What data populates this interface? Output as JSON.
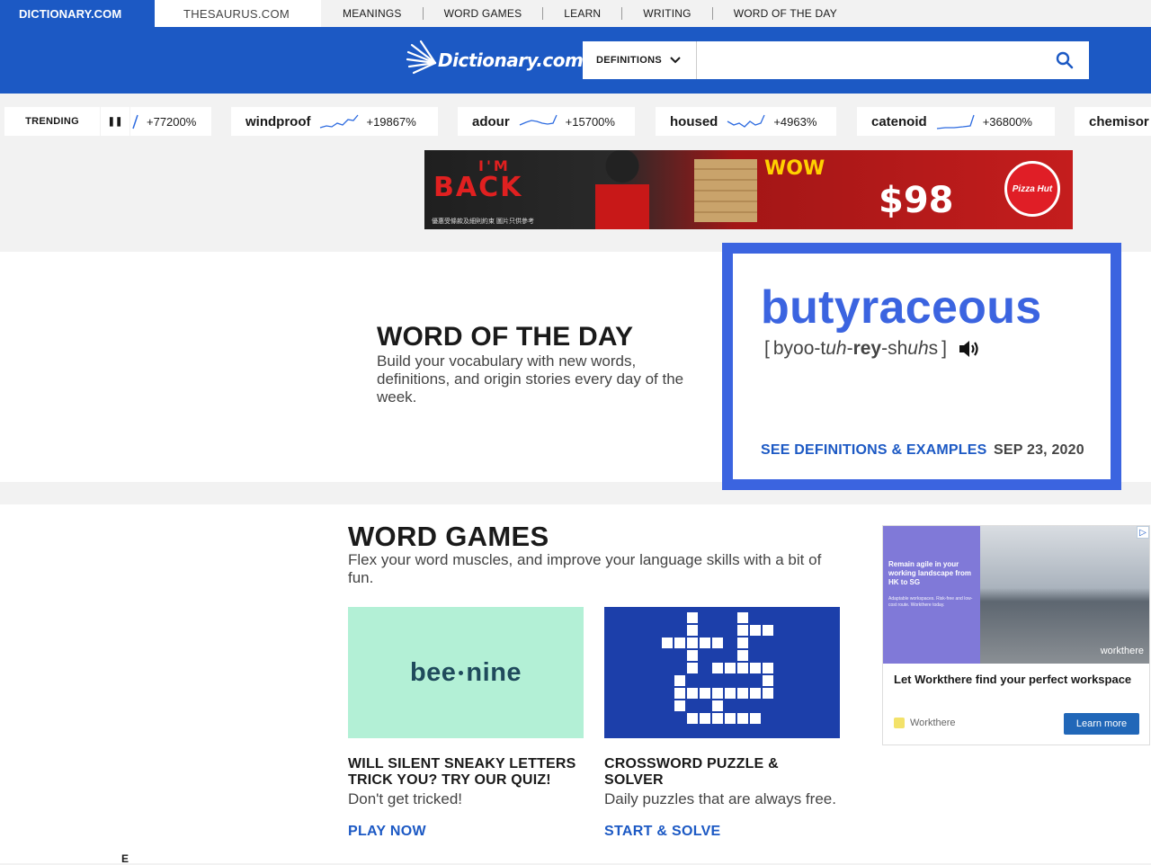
{
  "nav": {
    "brand": "DICTIONARY.COM",
    "thesaurus": "THESAURUS.COM",
    "links": [
      "MEANINGS",
      "WORD GAMES",
      "LEARN",
      "WRITING",
      "WORD OF THE DAY"
    ]
  },
  "header": {
    "logo_text": "Dictionary.com",
    "search_mode": "DEFINITIONS",
    "search_value": "",
    "search_icon": "search-icon"
  },
  "trending": {
    "label": "TRENDING",
    "pause_icon": "pause-icon",
    "first_pct": "+77200%",
    "items": [
      {
        "word": "windproof",
        "pct": "+19867%"
      },
      {
        "word": "adour",
        "pct": "+15700%"
      },
      {
        "word": "housed",
        "pct": "+4963%"
      },
      {
        "word": "catenoid",
        "pct": "+36800%"
      },
      {
        "word": "chemisor",
        "pct": ""
      }
    ]
  },
  "ad_banner": {
    "im": "I'M",
    "back": "BACK",
    "wow": "WOW",
    "price": "$98",
    "logo": "Pizza Hut",
    "fine": "優惠受條款及細則約束  圖片只供參考"
  },
  "wotd": {
    "heading": "WORD OF THE DAY",
    "description": "Build your vocabulary with new words, definitions, and origin stories every day of the week.",
    "word": "butyraceous",
    "pron_parts": [
      "byoo-t",
      "uh",
      "-",
      "rey",
      "-sh",
      "uh",
      "s"
    ],
    "link": "SEE DEFINITIONS & EXAMPLES",
    "date": "SEP 23, 2020",
    "audio_icon": "speaker-icon"
  },
  "games": {
    "heading": "WORD GAMES",
    "description": "Flex your word muscles, and improve your language skills with a bit of fun.",
    "items": [
      {
        "logo_a": "bee",
        "logo_b": "nine",
        "title": "WILL SILENT SNEAKY LETTERS TRICK YOU? TRY OUR QUIZ!",
        "sub": "Don't get tricked!",
        "cta": "PLAY NOW"
      },
      {
        "title": "CROSSWORD PUZZLE & SOLVER",
        "sub": "Daily puzzles that are always free.",
        "cta": "START & SOLVE"
      }
    ]
  },
  "side_ad": {
    "img_text": "Remain agile in your working landscape from HK to SG",
    "img_fine": "Adaptable workspaces. Risk-free and low-cost route. Workthere today.",
    "img_brand": "workthere",
    "headline": "Let Workthere find your perfect workspace",
    "brand": "Workthere",
    "cta": "Learn more"
  },
  "fragment": "E"
}
